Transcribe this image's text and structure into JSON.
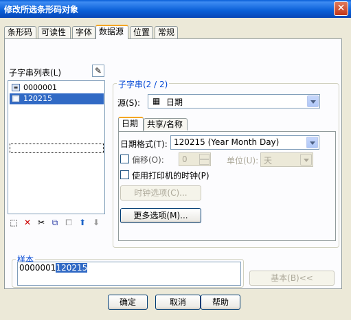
{
  "window": {
    "title": "修改所选条形码对象",
    "close_glyph": "✕"
  },
  "tabs": [
    {
      "label": "条形码"
    },
    {
      "label": "可读性"
    },
    {
      "label": "字体"
    },
    {
      "label": "数据源"
    },
    {
      "label": "位置"
    },
    {
      "label": "常规"
    }
  ],
  "active_tab": "数据源",
  "substring_list": {
    "label": "子字串列表(L)",
    "items": [
      {
        "label": "0000001",
        "icon": "text-source-icon"
      },
      {
        "label": "120215",
        "icon": "date-source-icon",
        "selected": true
      }
    ],
    "toolbar_icons": [
      "add-icon",
      "delete-icon",
      "cut-icon",
      "copy-icon",
      "paste-icon",
      "move-up-icon",
      "move-down-icon"
    ]
  },
  "substring_group": {
    "title": "子字串(2 / 2)",
    "source_label": "源(S):",
    "source_value": "日期",
    "inner_tabs": [
      {
        "label": "日期"
      },
      {
        "label": "共享/名称"
      }
    ],
    "date_format_label": "日期格式(T):",
    "date_format_value": "120215 (Year Month Day)",
    "offset_label": "偏移(O):",
    "offset_value": "0",
    "unit_label": "单位(U):",
    "unit_value": "天",
    "printer_clock_label": "使用打印机的时钟(P)",
    "clock_options_button": "时钟选项(C)...",
    "more_options_button": "更多选项(M)..."
  },
  "sample": {
    "title": "样本",
    "prefix": "0000001",
    "highlighted": "120215"
  },
  "basic_button": "基本(B)<<",
  "footer": {
    "ok": "确定",
    "cancel": "取消",
    "help": "帮助"
  },
  "colors": {
    "title_bar": "#0a5fd8",
    "selection": "#316ac5",
    "group_title": "#0046d5",
    "tab_accent": "#f5a623"
  }
}
